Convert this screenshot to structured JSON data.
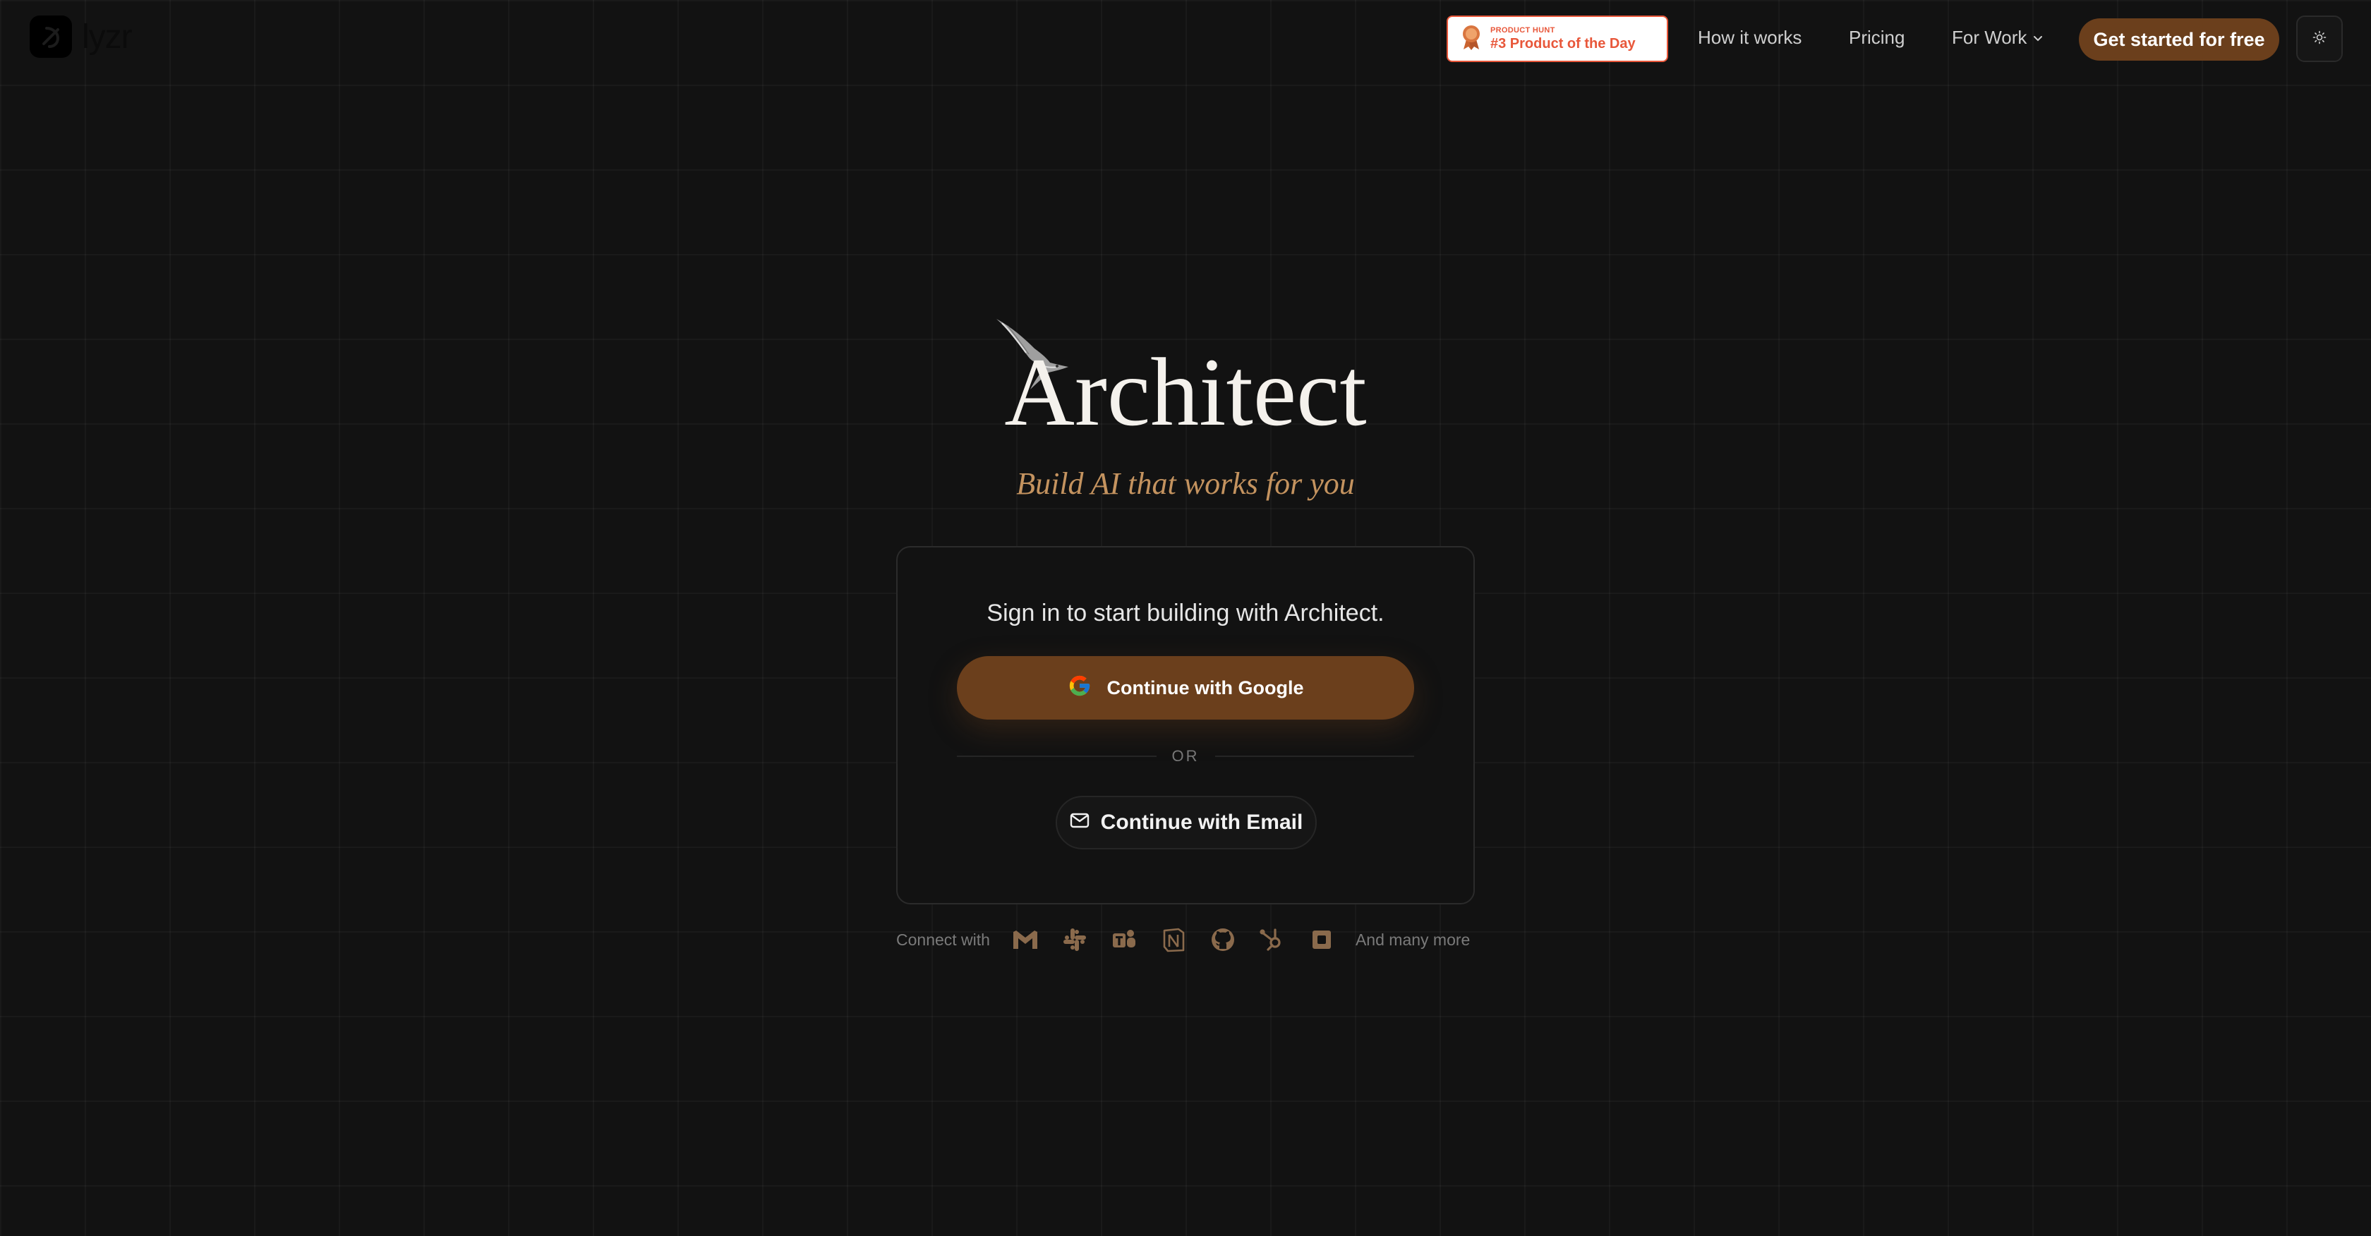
{
  "brand": {
    "name": "lyzr"
  },
  "header": {
    "badge": {
      "kicker": "PRODUCT HUNT",
      "title": "#3 Product of the Day"
    },
    "nav": [
      {
        "label": "How it works"
      },
      {
        "label": "Pricing"
      },
      {
        "label": "For Work"
      }
    ],
    "cta_label": "Get started for free"
  },
  "hero": {
    "title": "Architect",
    "tagline": "Build AI that works for you"
  },
  "signin": {
    "heading": "Sign in to start building with Architect.",
    "google_label": "Continue with Google",
    "or_label": "OR",
    "email_label": "Continue with Email"
  },
  "integrations": {
    "label": "Connect with",
    "more_label": "And many more",
    "icons": [
      "gmail-icon",
      "slack-icon",
      "teams-icon",
      "notion-icon",
      "github-icon",
      "hubspot-icon",
      "generic-app-icon"
    ]
  },
  "colors": {
    "background": "#121212",
    "accent": "#6b3f1c",
    "tagline": "#c4935f",
    "badge": "#e8573a",
    "icon": "#8a6a4c"
  }
}
